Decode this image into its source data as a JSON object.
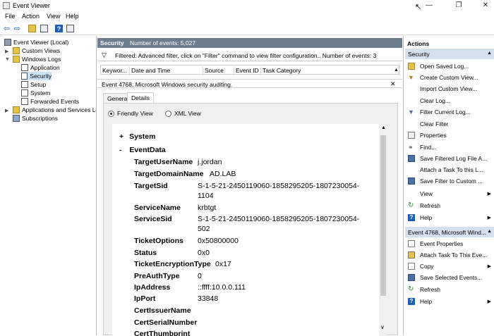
{
  "window": {
    "title": "Event Viewer"
  },
  "menu": [
    "File",
    "Action",
    "View",
    "Help"
  ],
  "tree": [
    {
      "label": "Event Viewer (Local)"
    },
    {
      "label": "Custom Views"
    },
    {
      "label": "Windows Logs"
    },
    {
      "label": "Application"
    },
    {
      "label": "Security"
    },
    {
      "label": "Setup"
    },
    {
      "label": "System"
    },
    {
      "label": "Forwarded Events"
    },
    {
      "label": "Applications and Services Lo"
    },
    {
      "label": "Subscriptions"
    }
  ],
  "center": {
    "log_name": "Security",
    "event_count": "Number of events: 5,027",
    "filter_text": "Filtered: Advanced filter, click on \"Filter\" command to view filter configuration.. Number of events: 3",
    "columns": [
      "Keywor...",
      "Date and Time",
      "Source",
      "Event ID",
      "Task Category"
    ],
    "event_header": "Event 4768, Microsoft Windows security auditing.",
    "close_glyph": "✕",
    "tabs": [
      "General",
      "Details"
    ],
    "radios": [
      "Friendly View",
      "XML View"
    ],
    "system_label": "System",
    "eventdata_label": "EventData",
    "plus": "+",
    "minus": "-",
    "fields": [
      {
        "key": "TargetUserName",
        "value": "j.jordan"
      },
      {
        "key": "TargetDomainName",
        "value": "AD.LAB"
      },
      {
        "key": "TargetSid",
        "value": "S-1-5-21-2450119060-1858295205-1807230054-",
        "value2": "1104"
      },
      {
        "key": "ServiceName",
        "value": "krbtgt"
      },
      {
        "key": "ServiceSid",
        "value": "S-1-5-21-2450119060-1858295205-1807230054-",
        "value2": "502"
      },
      {
        "key": "TicketOptions",
        "value": "0x50800000"
      },
      {
        "key": "Status",
        "value": "0x0"
      },
      {
        "key": "TicketEncryptionType",
        "value": "0x17"
      },
      {
        "key": "PreAuthType",
        "value": "0"
      },
      {
        "key": "IpAddress",
        "value": "::ffff:10.0.0.111"
      },
      {
        "key": "IpPort",
        "value": "33848"
      },
      {
        "key": "CertIssuerName",
        "value": ""
      },
      {
        "key": "CertSerialNumber",
        "value": ""
      },
      {
        "key": "CertThumbprint",
        "value": ""
      }
    ]
  },
  "actions": {
    "title": "Actions",
    "section1": "Security",
    "items1": [
      "Open Saved Log...",
      "Create Custom View...",
      "Import Custom View...",
      "Clear Log...",
      "Filter Current Log...",
      "Clear Filter",
      "Properties",
      "Find...",
      "Save Filtered Log File A...",
      "Attach a Task To this L...",
      "Save Filter to Custom ...",
      "View",
      "Refresh",
      "Help"
    ],
    "section2": "Event 4768, Microsoft Wind...",
    "items2": [
      "Event Properties",
      "Attach Task To This Eve...",
      "Copy",
      "Save Selected Events...",
      "Refresh",
      "Help"
    ]
  },
  "colors": {
    "accent": "#d5e0ef",
    "header": "#6e7c8f",
    "selected": "#cce4f7"
  }
}
